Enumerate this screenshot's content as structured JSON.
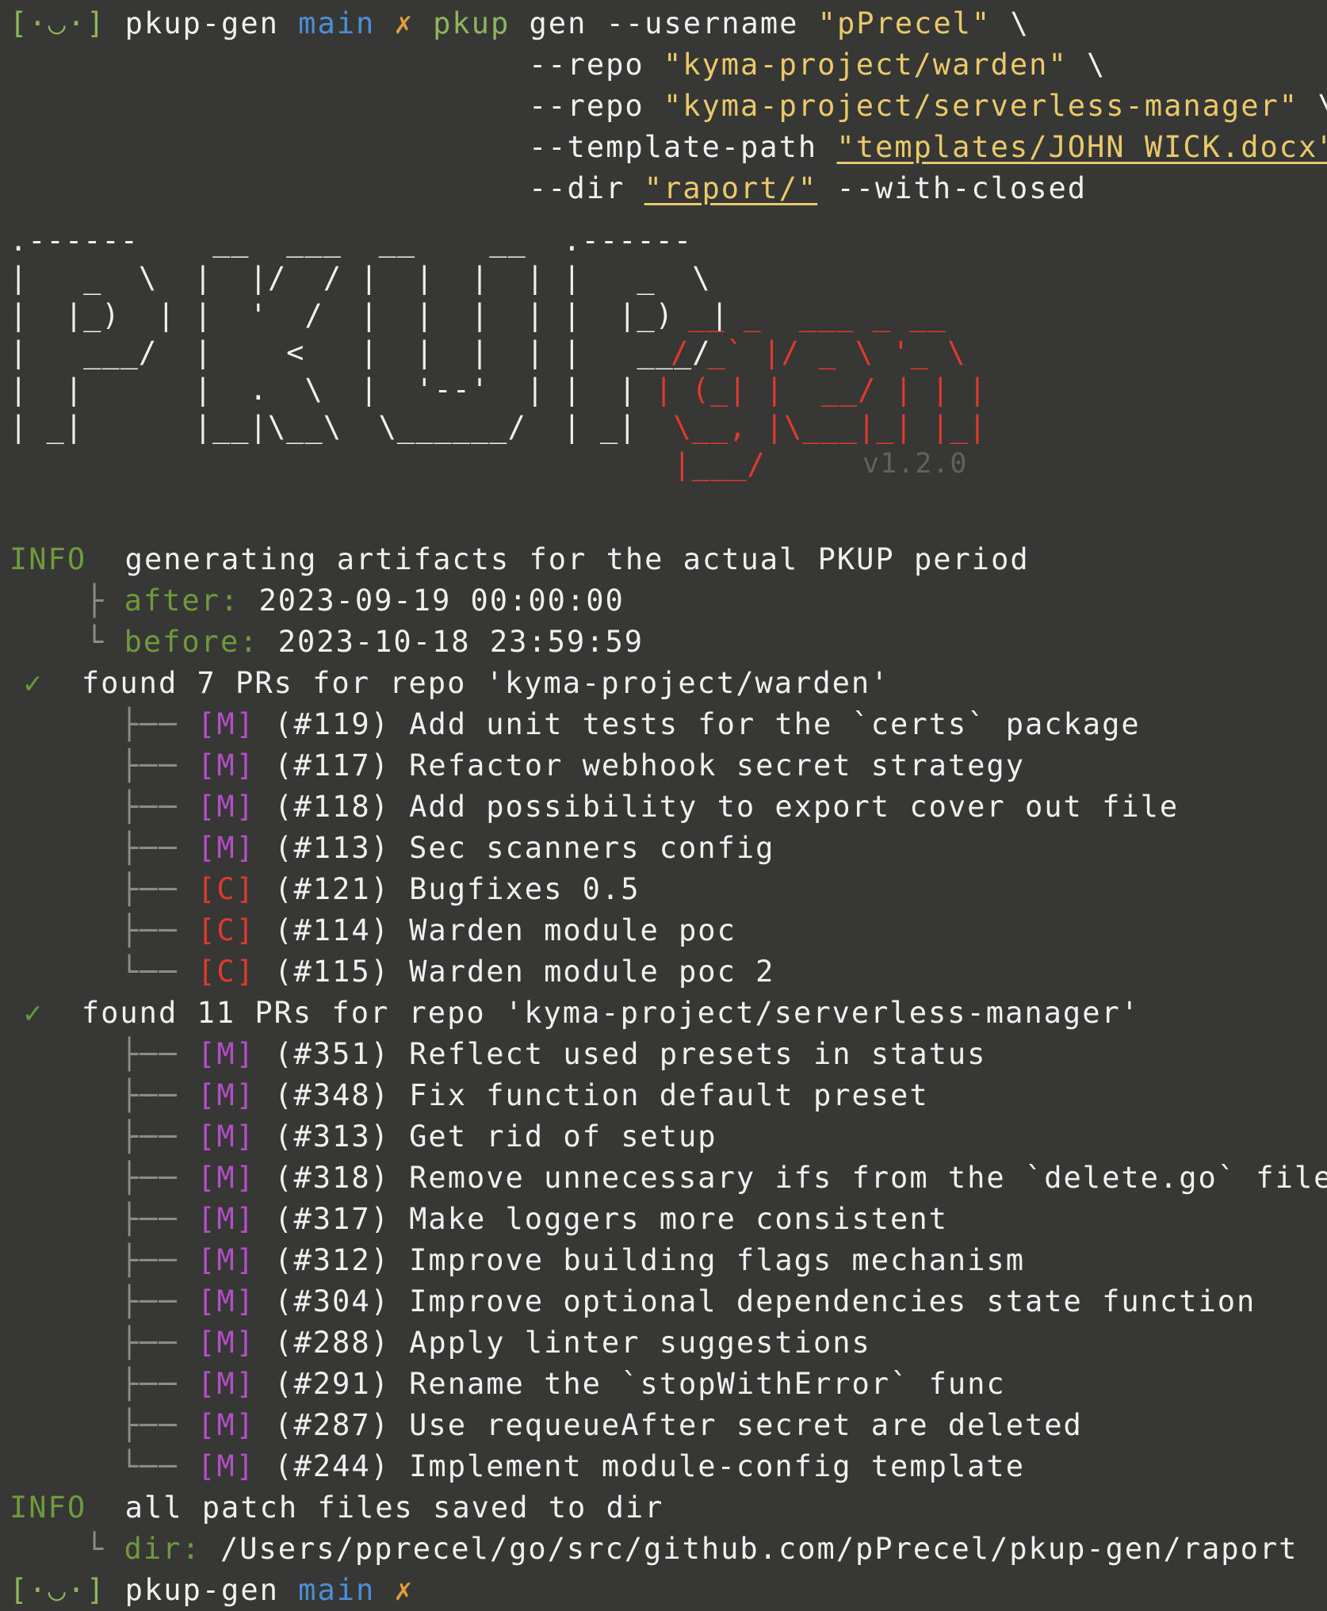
{
  "prompt": {
    "bracket_open": "[",
    "face": "·◡·",
    "bracket_close": "]",
    "dir": "pkup-gen",
    "branch": "main",
    "dirty": "✗"
  },
  "command": {
    "cmd": "pkup",
    "sub": "gen",
    "line1_flag": "--username",
    "line1_val": "\"pPrecel\"",
    "cont": "\\",
    "line2_flag": "--repo",
    "line2_val": "\"kyma-project/warden\"",
    "line3_flag": "--repo",
    "line3_val": "\"kyma-project/serverless-manager\"",
    "line4_flag": "--template-path",
    "line4_val": "\"templates/JOHN_WICK.docx\"",
    "line5_flag": "--dir",
    "line5_val": "\"raport/\"",
    "line5_tail": "--with-closed"
  },
  "banner": {
    "rows_white": [
      ".------    __  ___  __    __  .------",
      "|   _  \\  |  |/  / |  |  |  | |   _  \\",
      "|  |_)  | |  '  /  |  |  |  | |  |_)  |",
      "|   ___/  |    <   |  |  |  | |   ___/",
      "|  |      |  .  \\  |  '--'  | |  |",
      "| _|      |__|\\__\\  \\______/  | _|",
      ""
    ],
    "rows_red": [
      "",
      "",
      "__ _  ___ _ __",
      "/ _` |/ _ \\ '_ \\",
      "| (_| |  __/ | | |",
      " \\__, |\\___|_| |_|",
      " |___/"
    ],
    "version": "v1.2.0"
  },
  "log": {
    "info_label": "INFO",
    "info1": "generating artifacts for the actual PKUP period",
    "after_label": "after:",
    "after_val": "2023-09-19 00:00:00",
    "before_label": "before:",
    "before_val": "2023-10-18 23:59:59",
    "check": "✓",
    "repo1_line": "found 7 PRs for repo 'kyma-project/warden'",
    "repo1_prs": [
      {
        "tag": "[M]",
        "num": "(#119)",
        "title": "Add unit tests for the `certs` package"
      },
      {
        "tag": "[M]",
        "num": "(#117)",
        "title": "Refactor webhook secret strategy"
      },
      {
        "tag": "[M]",
        "num": "(#118)",
        "title": "Add possibility to export cover out file"
      },
      {
        "tag": "[M]",
        "num": "(#113)",
        "title": "Sec scanners config"
      },
      {
        "tag": "[C]",
        "num": "(#121)",
        "title": "Bugfixes 0.5"
      },
      {
        "tag": "[C]",
        "num": "(#114)",
        "title": "Warden module poc"
      },
      {
        "tag": "[C]",
        "num": "(#115)",
        "title": "Warden module poc 2"
      }
    ],
    "repo2_line": "found 11 PRs for repo 'kyma-project/serverless-manager'",
    "repo2_prs": [
      {
        "tag": "[M]",
        "num": "(#351)",
        "title": "Reflect used presets in status"
      },
      {
        "tag": "[M]",
        "num": "(#348)",
        "title": "Fix function default preset"
      },
      {
        "tag": "[M]",
        "num": "(#313)",
        "title": "Get rid of setup"
      },
      {
        "tag": "[M]",
        "num": "(#318)",
        "title": "Remove unnecessary ifs from the `delete.go` file"
      },
      {
        "tag": "[M]",
        "num": "(#317)",
        "title": "Make loggers more consistent"
      },
      {
        "tag": "[M]",
        "num": "(#312)",
        "title": "Improve building flags mechanism"
      },
      {
        "tag": "[M]",
        "num": "(#304)",
        "title": "Improve optional dependencies state function"
      },
      {
        "tag": "[M]",
        "num": "(#288)",
        "title": "Apply linter suggestions"
      },
      {
        "tag": "[M]",
        "num": "(#291)",
        "title": "Rename the `stopWithError` func"
      },
      {
        "tag": "[M]",
        "num": "(#287)",
        "title": "Use requeueAfter secret are deleted"
      },
      {
        "tag": "[M]",
        "num": "(#244)",
        "title": "Implement module-config template"
      }
    ],
    "info2": "all patch files saved to dir",
    "dir_label": "dir:",
    "dir_val": "/Users/pprecel/go/src/github.com/pPrecel/pkup-gen/raport"
  },
  "colors": {
    "background": "#373836",
    "merged_tag": "#b24fc6",
    "closed_tag": "#e03a2e",
    "info": "#6e9a3c",
    "branch": "#4b8fd8",
    "string": "#eac96a"
  }
}
